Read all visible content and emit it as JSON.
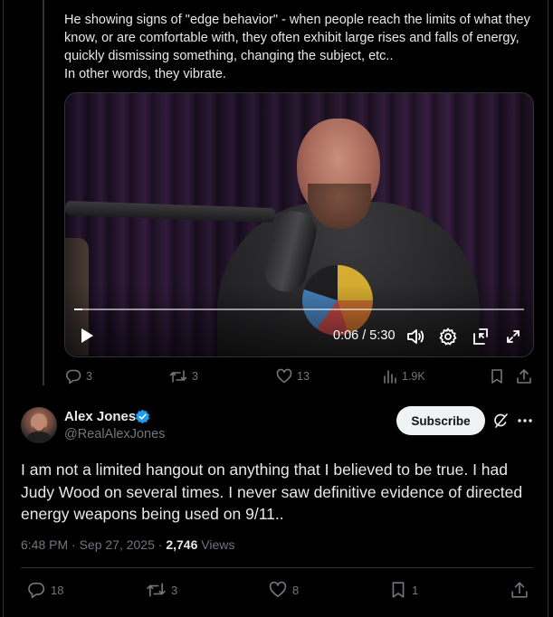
{
  "quoted_post": {
    "text": "He showing signs of \"edge behavior\" - when people reach the limits of what they know, or are comfortable with, they often exhibit large rises and falls of energy, quickly dismissing something, changing the subject, etc..\nIn other words, they vibrate.",
    "video": {
      "time": "0:06 / 5:30",
      "progress": 0.018
    },
    "actions": {
      "replies": "3",
      "reposts": "3",
      "likes": "13",
      "views": "1.9K"
    }
  },
  "post": {
    "author_name": "Alex Jones",
    "handle": "@RealAlexJones",
    "subscribe_label": "Subscribe",
    "text": "I am not a limited hangout on anything that I believed to be true. I had Judy Wood on several times. I never saw definitive evidence of directed energy weapons being used on 9/11..",
    "time": "6:48 PM · Sep 27, 2025 · ",
    "views_count": "2,746",
    "views_label": " Views",
    "actions": {
      "replies": "18",
      "reposts": "3",
      "likes": "8",
      "bookmarks": "1"
    }
  },
  "colors": {
    "background": "#000000",
    "text": "#e7e9ea",
    "muted": "#71767b",
    "verified": "#1d9bf0",
    "divider": "#2f3336"
  }
}
